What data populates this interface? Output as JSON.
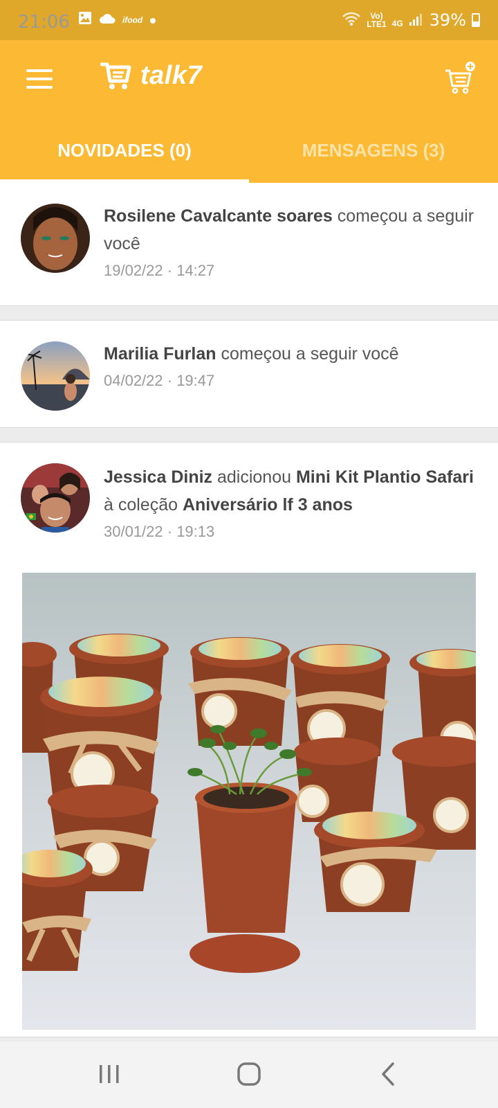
{
  "status_bar": {
    "time": "21:06",
    "battery": "39%",
    "volte_top": "Vo)",
    "volte_bottom": "LTE1",
    "network": "4G",
    "notif_label": "ifood",
    "icons": [
      "image-icon",
      "cloud-icon",
      "ifood-icon",
      "dot-icon",
      "wifi-icon",
      "volte-icon",
      "signal-icon",
      "battery-icon"
    ]
  },
  "app_bar": {
    "brand": "talk7",
    "menu_icon": "hamburger-icon",
    "cart_icon": "cart-add-icon"
  },
  "tabs": [
    {
      "label": "NOVIDADES (0)",
      "active": true
    },
    {
      "label": "MENSAGENS (3)",
      "active": false
    }
  ],
  "feed": [
    {
      "user": "Rosilene Cavalcante soares",
      "action": "começou a seguir você",
      "time": "19/02/22 · 14:27"
    },
    {
      "user": "Marilia Furlan",
      "action": "começou a seguir você",
      "time": "04/02/22 · 19:47"
    },
    {
      "user": "Jessica Diniz",
      "action": "adicionou",
      "product": "Mini Kit Plantio Safari",
      "connector": "à coleção",
      "collection": "Aniversário lf 3 anos",
      "time": "30/01/22 · 19:13"
    }
  ],
  "colors": {
    "status_bar": "#e0a82a",
    "app_bar": "#fbb934",
    "feed_bg": "#ececec"
  },
  "nav_bar": {
    "recent_icon": "recent-apps-icon",
    "home_icon": "home-icon",
    "back_icon": "back-icon"
  }
}
